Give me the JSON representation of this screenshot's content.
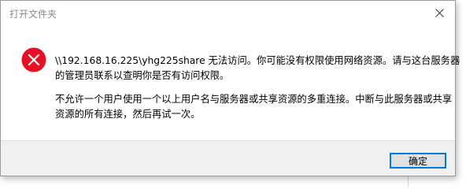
{
  "dialog": {
    "title": "打开文件夹",
    "close_icon": "close-icon",
    "icon": "error-icon",
    "message1": [
      "\\\\192.168.16.225\\yhg225share 无法访问。你可能没有权限使用网络资源。请与这台服务器",
      "的管理员联系以查明你是否有访问权限。"
    ],
    "message2": [
      "不允许一个用户使用一个以上用户名与服务器或共享资源的多重连接。中断与此服务器或共享",
      "资源的所有连接，然后再试一次。"
    ],
    "ok_label": "确定",
    "colors": {
      "error_red": "#e81123",
      "button_border": "#0078d7",
      "footer_bg": "#f0f0f0"
    }
  }
}
